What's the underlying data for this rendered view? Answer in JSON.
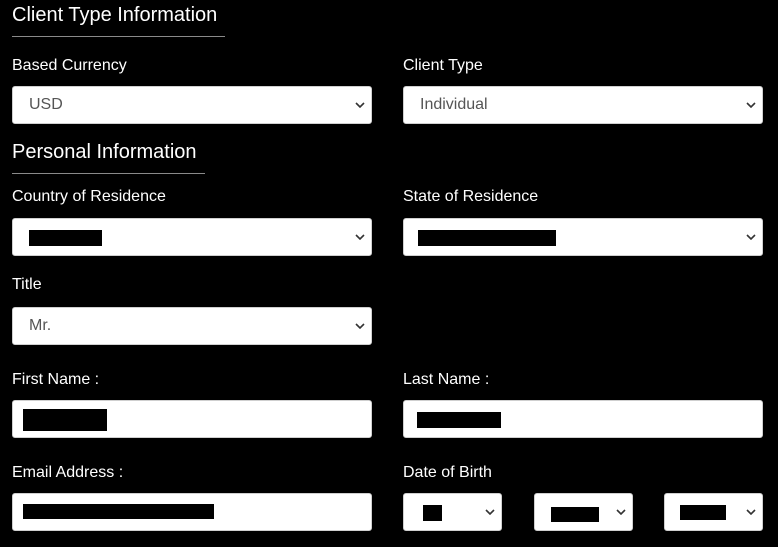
{
  "client_type_section": {
    "title": "Client Type Information",
    "based_currency": {
      "label": "Based Currency",
      "value": "USD"
    },
    "client_type": {
      "label": "Client Type",
      "value": "Individual"
    }
  },
  "personal_section": {
    "title": "Personal Information",
    "country": {
      "label": "Country of Residence",
      "value": ""
    },
    "state": {
      "label": "State of Residence",
      "value": ""
    },
    "title_field": {
      "label": "Title",
      "value": "Mr."
    },
    "first_name": {
      "label": "First Name :",
      "value": ""
    },
    "last_name": {
      "label": "Last Name :",
      "value": ""
    },
    "email": {
      "label": "Email Address :",
      "value": ""
    },
    "dob": {
      "label": "Date of Birth",
      "day": "",
      "month": "",
      "year": ""
    }
  },
  "icons": {
    "select_arrow": "chevron-down-icon"
  },
  "colors": {
    "background": "#000000",
    "field": "#ffffff",
    "redaction": "#000000"
  }
}
